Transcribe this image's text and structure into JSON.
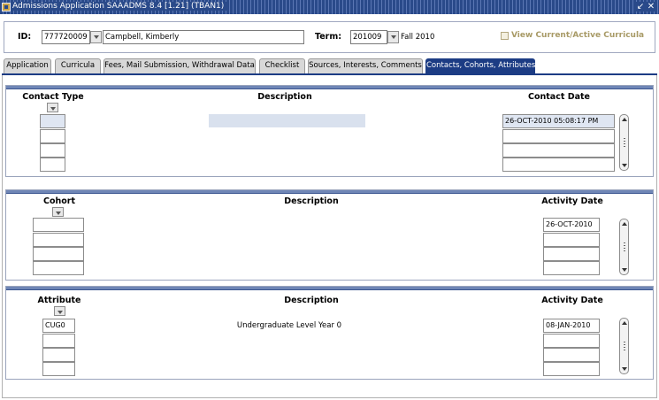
{
  "window": {
    "title": "Admissions Application  SAAADMS  8.4  [1.21]  (TBAN1)",
    "min_icon": "minimize-icon",
    "close_icon": "close-icon"
  },
  "key": {
    "id_label": "ID:",
    "id_value": "777720009",
    "name_value": "Campbell, Kimberly",
    "term_label": "Term:",
    "term_value": "201009",
    "term_desc": "Fall 2010",
    "curricula_label": "View Current/Active Curricula"
  },
  "tabs": [
    {
      "label": "Application"
    },
    {
      "label": "Curricula"
    },
    {
      "label": "Fees, Mail Submission, Withdrawal Data"
    },
    {
      "label": "Checklist"
    },
    {
      "label": "Sources, Interests, Comments"
    },
    {
      "label": "Contacts, Cohorts, Attributes"
    }
  ],
  "contacts": {
    "col_type": "Contact Type",
    "col_desc": "Description",
    "col_date": "Contact Date",
    "rows": [
      {
        "type": "",
        "date": "26-OCT-2010 05:08:17 PM"
      },
      {
        "type": "",
        "date": ""
      },
      {
        "type": "",
        "date": ""
      },
      {
        "type": "",
        "date": ""
      }
    ]
  },
  "cohorts": {
    "col_cohort": "Cohort",
    "col_desc": "Description",
    "col_date": "Activity Date",
    "rows": [
      {
        "cohort": "",
        "date": "26-OCT-2010"
      },
      {
        "cohort": "",
        "date": ""
      },
      {
        "cohort": "",
        "date": ""
      },
      {
        "cohort": "",
        "date": ""
      }
    ]
  },
  "attributes": {
    "col_attr": "Attribute",
    "col_desc": "Description",
    "col_date": "Activity Date",
    "rows": [
      {
        "attr": "CUG0",
        "desc": "Undergraduate Level Year 0",
        "date": "08-JAN-2010"
      },
      {
        "attr": "",
        "desc": "",
        "date": ""
      },
      {
        "attr": "",
        "desc": "",
        "date": ""
      },
      {
        "attr": "",
        "desc": "",
        "date": ""
      }
    ]
  },
  "colors": {
    "active_tab": "#1c3c84",
    "title_bar": "#2a4a8a",
    "block_bar": "#6f86b6"
  }
}
